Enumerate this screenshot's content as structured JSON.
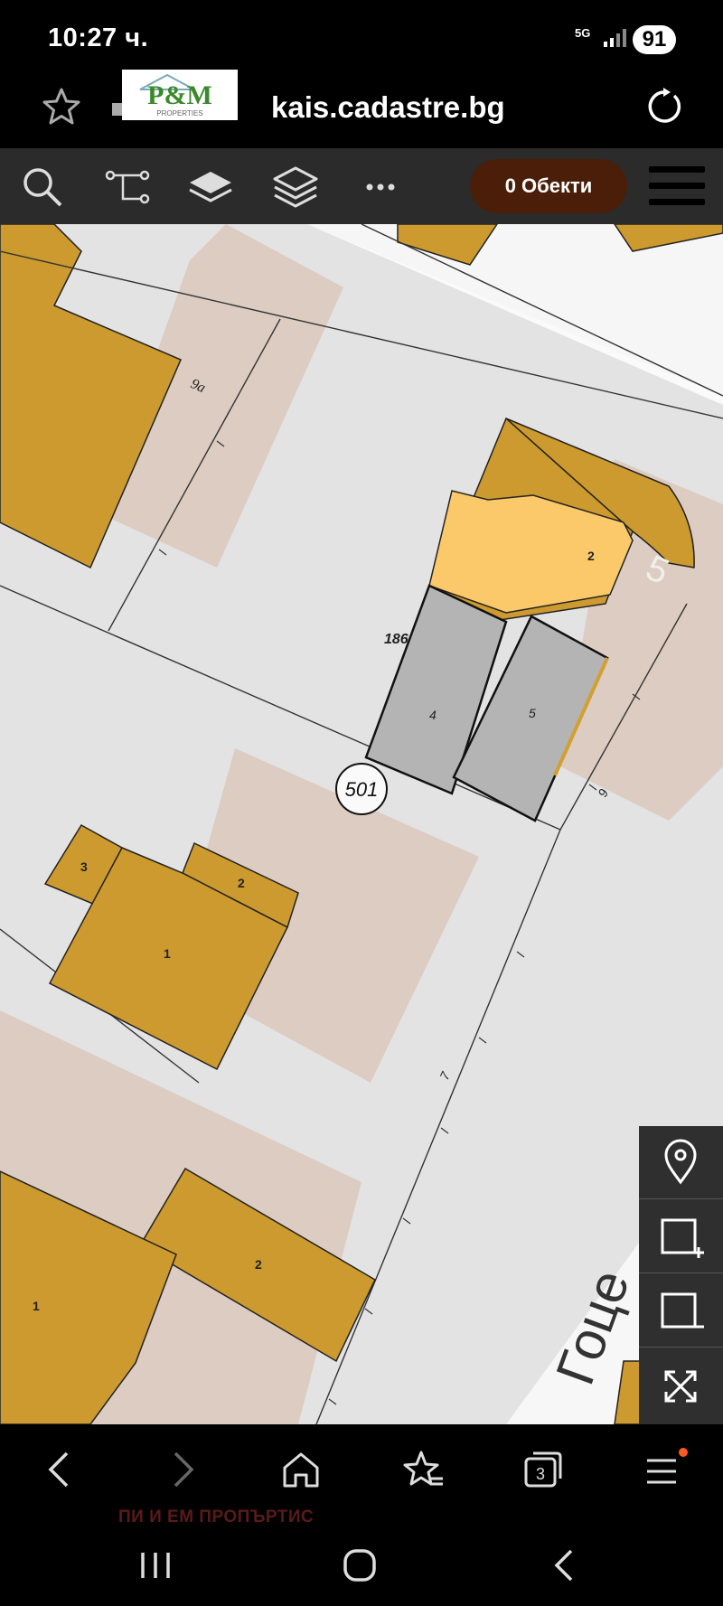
{
  "status_bar": {
    "time": "10:27 ч.",
    "network": "5G",
    "battery": "91"
  },
  "browser": {
    "url": "kais.cadastre.bg",
    "logo_text": "P&M",
    "logo_subtext": "PROPERTIES"
  },
  "toolbar": {
    "icons": [
      "search-icon",
      "route-icon",
      "layer-icon",
      "layers-icon",
      "more-icon"
    ],
    "objects_button": "0 Обекти"
  },
  "map": {
    "labels": {
      "plot_id": "186",
      "parcel_circle": "501",
      "addr_9a": "9а",
      "addr_9": "9",
      "addr_7": "7",
      "street": "Гоце"
    },
    "buildings_main": {
      "b2": "2",
      "b4": "4",
      "b5": "5"
    },
    "buildings_lower": {
      "b3": "3",
      "b2": "2",
      "b1": "1"
    },
    "buildings_bottom": {
      "b1": "1",
      "b2": "2"
    },
    "colors": {
      "background": "#e3e3e3",
      "building": "#cc9a2e",
      "highlight": "#fcc96a",
      "selected": "#b4b4b4",
      "shade": "#dcccc2"
    }
  },
  "map_controls": [
    "location-pin-icon",
    "select-add-icon",
    "select-remove-icon",
    "fullscreen-icon"
  ],
  "watermark": "ПИ И ЕМ ПРОПЪРТИС"
}
